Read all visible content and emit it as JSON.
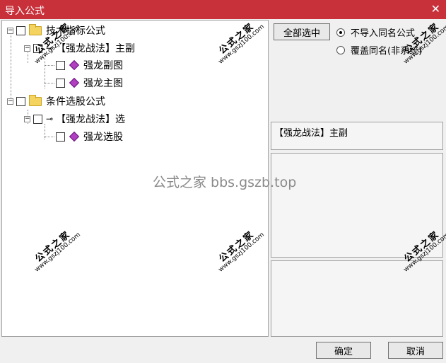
{
  "window": {
    "title": "导入公式",
    "close_glyph": "✕"
  },
  "tree": {
    "groups": [
      {
        "label": "技术指标公式",
        "children": [
          {
            "label": "【强龙战法】主副",
            "children": [
              {
                "label": "强龙副图"
              },
              {
                "label": "强龙主图"
              }
            ]
          }
        ]
      },
      {
        "label": "条件选股公式",
        "children": [
          {
            "label": "【强龙战法】选",
            "children": [
              {
                "label": "强龙选股"
              }
            ]
          }
        ]
      }
    ]
  },
  "controls": {
    "select_all_label": "全部选中",
    "radio_no_import": "不导入同名公式",
    "radio_overwrite": "覆盖同名(非系统)",
    "selected_radio": "no_import"
  },
  "info": {
    "current_formula": "【强龙战法】主副"
  },
  "buttons": {
    "ok": "确定",
    "cancel": "取消"
  },
  "watermark": {
    "big": "公式之家",
    "small": "www.gszj100.com",
    "center": "公式之家 bbs.gszb.top"
  }
}
